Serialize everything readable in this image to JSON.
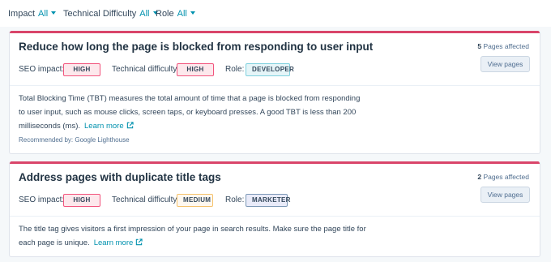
{
  "filters": [
    {
      "label": "Impact",
      "value": "All"
    },
    {
      "label": "Technical Difficulty",
      "value": "All"
    },
    {
      "label": "Role",
      "value": "All"
    }
  ],
  "meta_labels": {
    "seo_impact": "SEO impact:",
    "technical_difficulty": "Technical difficulty:",
    "role": "Role:"
  },
  "cards": [
    {
      "title": "Reduce how long the page is blocked from responding to user input",
      "seo_impact": "HIGH",
      "technical_difficulty": "HIGH",
      "role": "DEVELOPER",
      "pages_count": "5",
      "pages_label": "Pages affected",
      "view_button": "View pages",
      "description": "Total Blocking Time (TBT) measures the total amount of time that a page is blocked from responding to user input, such as mouse clicks, screen taps, or keyboard presses. A good TBT is less than 200 milliseconds (ms).",
      "learn_more": "Learn more",
      "recommended_by": "Recommended by: Google Lighthouse"
    },
    {
      "title": "Address pages with duplicate title tags",
      "seo_impact": "HIGH",
      "technical_difficulty": "MEDIUM",
      "role": "MARKETER",
      "pages_count": "2",
      "pages_label": "Pages affected",
      "view_button": "View pages",
      "description": "The title tag gives visitors a first impression of your page in search results. Make sure the page title for each page is unique.",
      "learn_more": "Learn more"
    }
  ],
  "colors": {
    "accent": "#0091ae",
    "card_top_bar": "#d9456a",
    "text": "#33475b"
  }
}
